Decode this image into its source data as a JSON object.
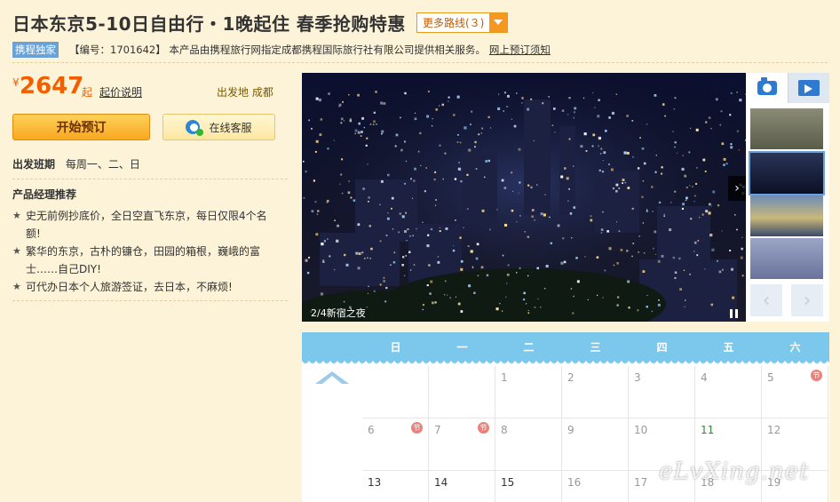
{
  "header": {
    "title": "日本东京5-10日自由行・1晚起住  春季抢购特惠",
    "more_routes": "更多路线(３)"
  },
  "sub": {
    "exclusive": "携程独家",
    "code": "【编号：1701642】 本产品由携程旅行网指定成都携程国际旅行社有限公司提供相关服务。",
    "link": "网上预订须知"
  },
  "price": {
    "currency": "¥",
    "amount": "2647",
    "qi": "起",
    "note": "起价说明",
    "depart": "出发地 成都"
  },
  "buttons": {
    "book": "开始预订",
    "service": "在线客服"
  },
  "schedule": {
    "label": "出发班期",
    "value": "每周一、二、日"
  },
  "manager": {
    "title": "产品经理推荐",
    "items": [
      "史无前例抄底价，全日空直飞东京，每日仅限4个名额!",
      "繁华的东京，古朴的镰仓，田园的箱根，巍峨的富士……自己DIY!",
      "可代办日本个人旅游签证，去日本，不麻烦!"
    ]
  },
  "gallery": {
    "caption": "2/4新宿之夜",
    "prev": "‹",
    "next": "›"
  },
  "calendar": {
    "weekdays": [
      "日",
      "一",
      "二",
      "三",
      "四",
      "五",
      "六"
    ],
    "holiday_mark": "节",
    "row1": [
      "",
      "",
      "1",
      "2",
      "3",
      "4",
      "5"
    ],
    "row2": [
      "6",
      "7",
      "8",
      "9",
      "10",
      "11",
      "12"
    ],
    "row3": [
      "13",
      "14",
      "15",
      "16",
      "17",
      "18",
      "19"
    ]
  },
  "watermark": "eLvXing.net",
  "colors": {
    "accent": "#f06000",
    "calendar_header": "#7cc8ec",
    "background": "#fdf3d8"
  }
}
